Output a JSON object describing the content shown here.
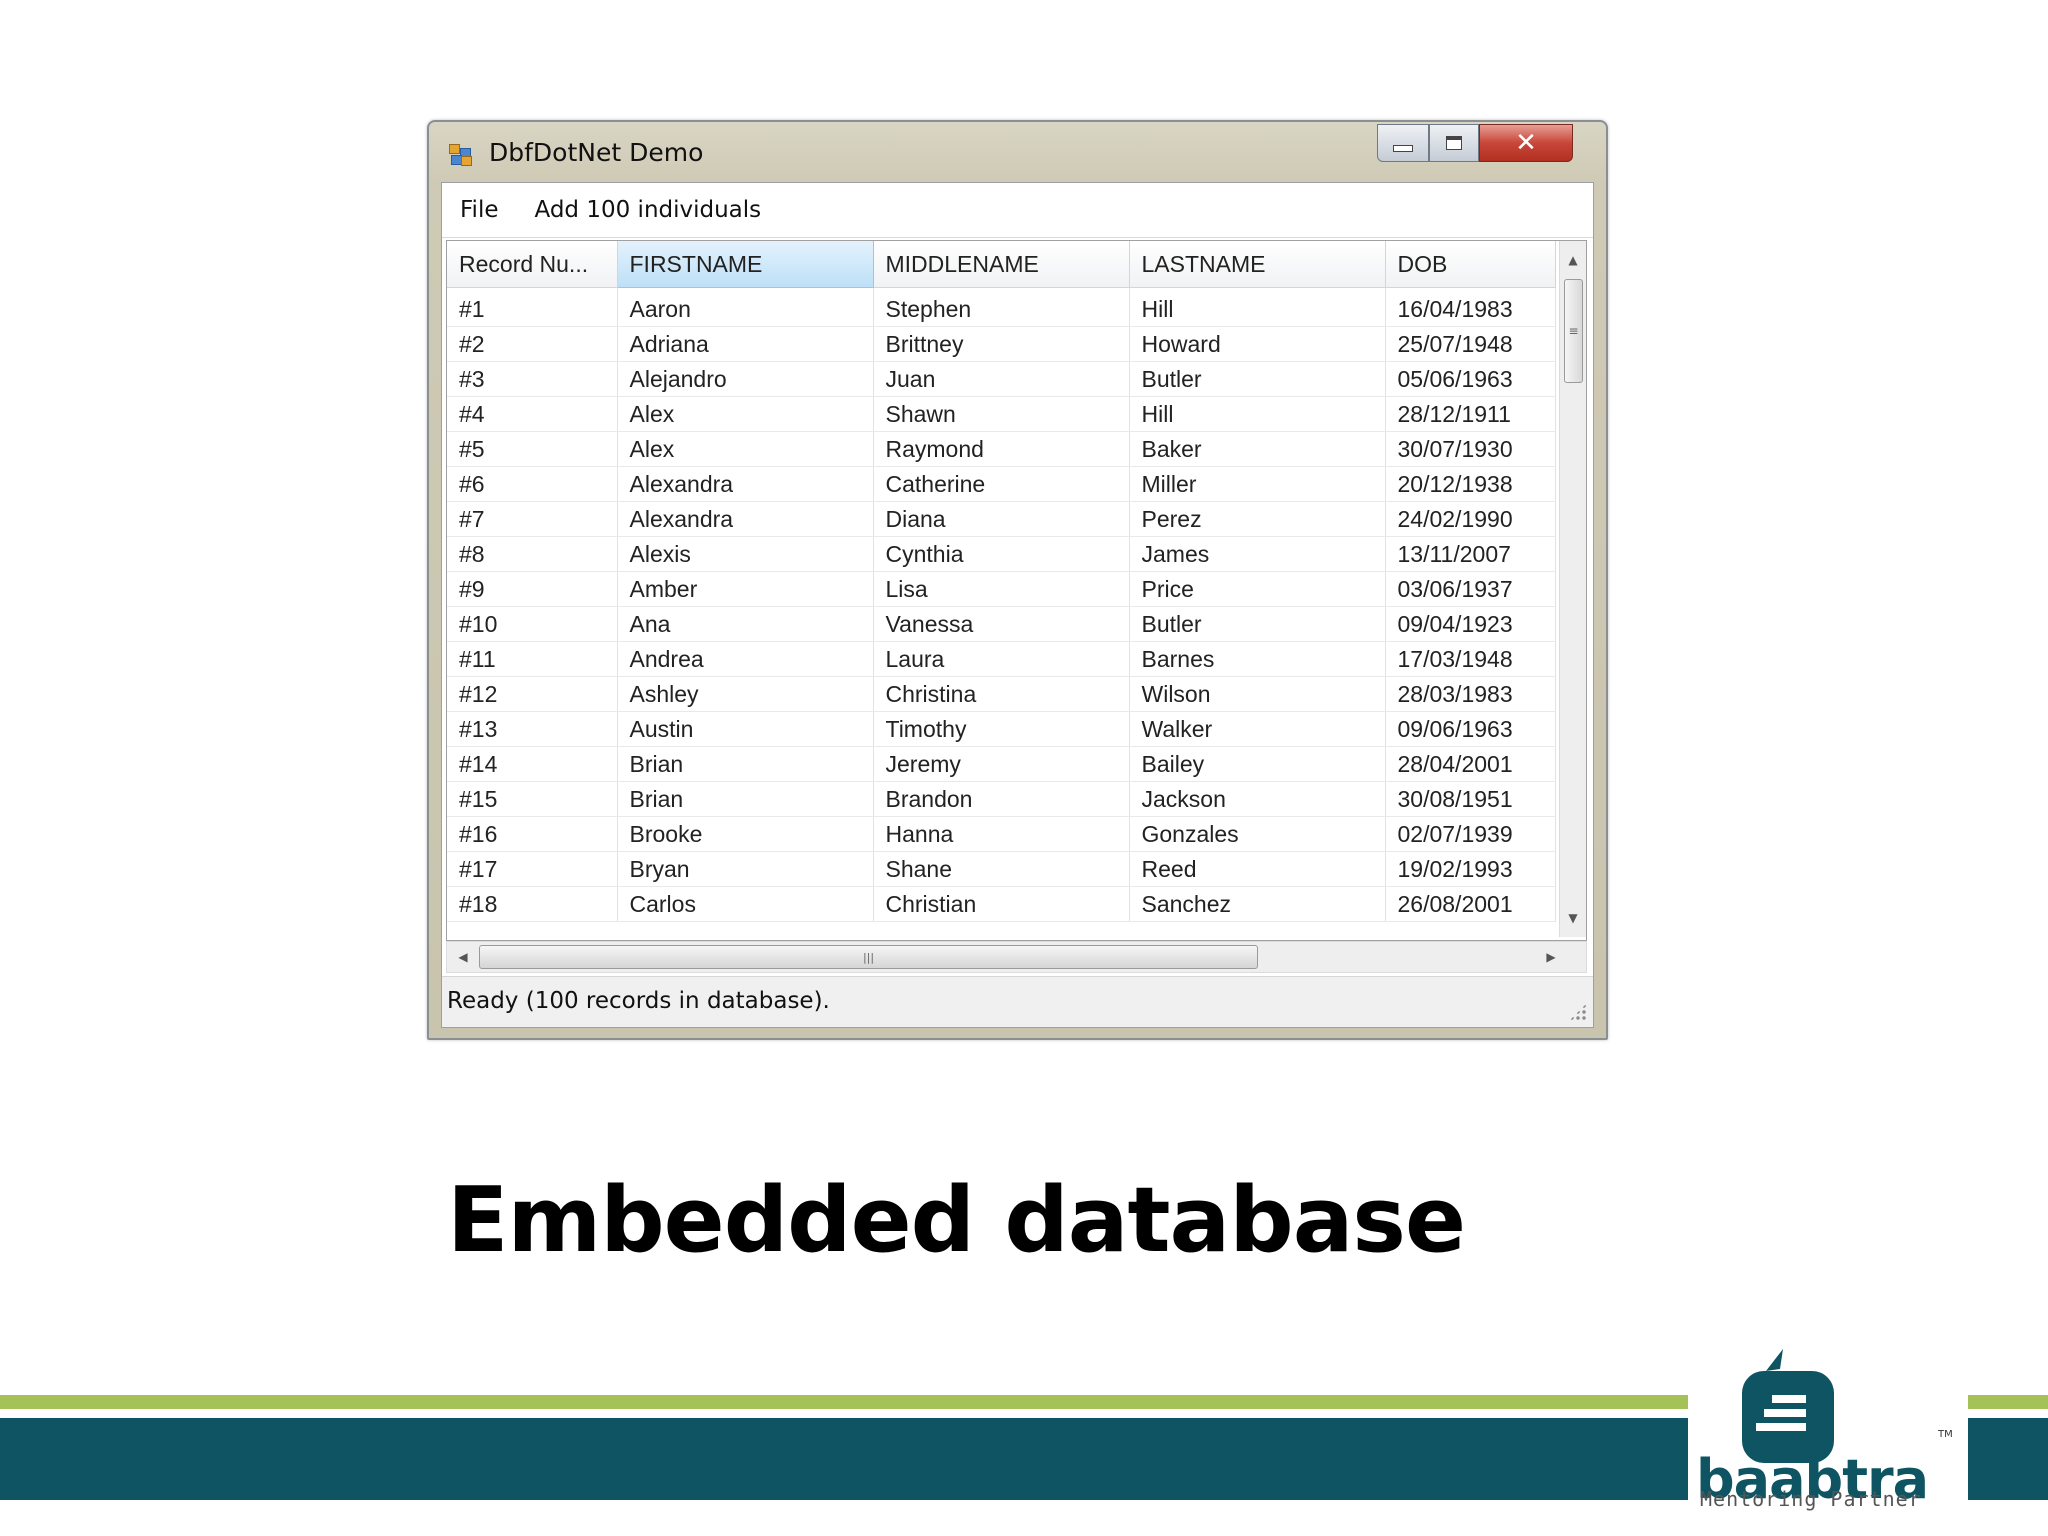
{
  "window": {
    "title": "DbfDotNet Demo",
    "close_glyph": "✕"
  },
  "menu": [
    {
      "label": "File"
    },
    {
      "label": "Add 100 individuals"
    }
  ],
  "grid": {
    "columns": [
      "Record Nu...",
      "FIRSTNAME",
      "MIDDLENAME",
      "LASTNAME",
      "DOB"
    ],
    "selected_column": "FIRSTNAME",
    "rows": [
      [
        "#1",
        "Aaron",
        "Stephen",
        "Hill",
        "16/04/1983"
      ],
      [
        "#2",
        "Adriana",
        "Brittney",
        "Howard",
        "25/07/1948"
      ],
      [
        "#3",
        "Alejandro",
        "Juan",
        "Butler",
        "05/06/1963"
      ],
      [
        "#4",
        "Alex",
        "Shawn",
        "Hill",
        "28/12/1911"
      ],
      [
        "#5",
        "Alex",
        "Raymond",
        "Baker",
        "30/07/1930"
      ],
      [
        "#6",
        "Alexandra",
        "Catherine",
        "Miller",
        "20/12/1938"
      ],
      [
        "#7",
        "Alexandra",
        "Diana",
        "Perez",
        "24/02/1990"
      ],
      [
        "#8",
        "Alexis",
        "Cynthia",
        "James",
        "13/11/2007"
      ],
      [
        "#9",
        "Amber",
        "Lisa",
        "Price",
        "03/06/1937"
      ],
      [
        "#10",
        "Ana",
        "Vanessa",
        "Butler",
        "09/04/1923"
      ],
      [
        "#11",
        "Andrea",
        "Laura",
        "Barnes",
        "17/03/1948"
      ],
      [
        "#12",
        "Ashley",
        "Christina",
        "Wilson",
        "28/03/1983"
      ],
      [
        "#13",
        "Austin",
        "Timothy",
        "Walker",
        "09/06/1963"
      ],
      [
        "#14",
        "Brian",
        "Jeremy",
        "Bailey",
        "28/04/2001"
      ],
      [
        "#15",
        "Brian",
        "Brandon",
        "Jackson",
        "30/08/1951"
      ],
      [
        "#16",
        "Brooke",
        "Hanna",
        "Gonzales",
        "02/07/1939"
      ],
      [
        "#17",
        "Bryan",
        "Shane",
        "Reed",
        "19/02/1993"
      ],
      [
        "#18",
        "Carlos",
        "Christian",
        "Sanchez",
        "26/08/2001"
      ]
    ]
  },
  "status": {
    "text": "Ready (100 records in database)."
  },
  "slide": {
    "heading": "Embedded database"
  },
  "logo": {
    "word": "baabtra",
    "tagline": "Mentoring Partner",
    "tm": "TM"
  },
  "colors": {
    "footer_green": "#a4c257",
    "footer_teal": "#0f5462",
    "selected_header": "#bde0f7",
    "close_button": "#c8463a"
  },
  "icons": {
    "app": "app-icon",
    "minimize": "minimize-icon",
    "maximize": "maximize-icon",
    "close": "close-icon",
    "scroll_up": "arrow-up-icon",
    "scroll_down": "arrow-down-icon",
    "scroll_left": "arrow-left-icon",
    "scroll_right": "arrow-right-icon",
    "resize_grip": "resize-grip-icon"
  }
}
